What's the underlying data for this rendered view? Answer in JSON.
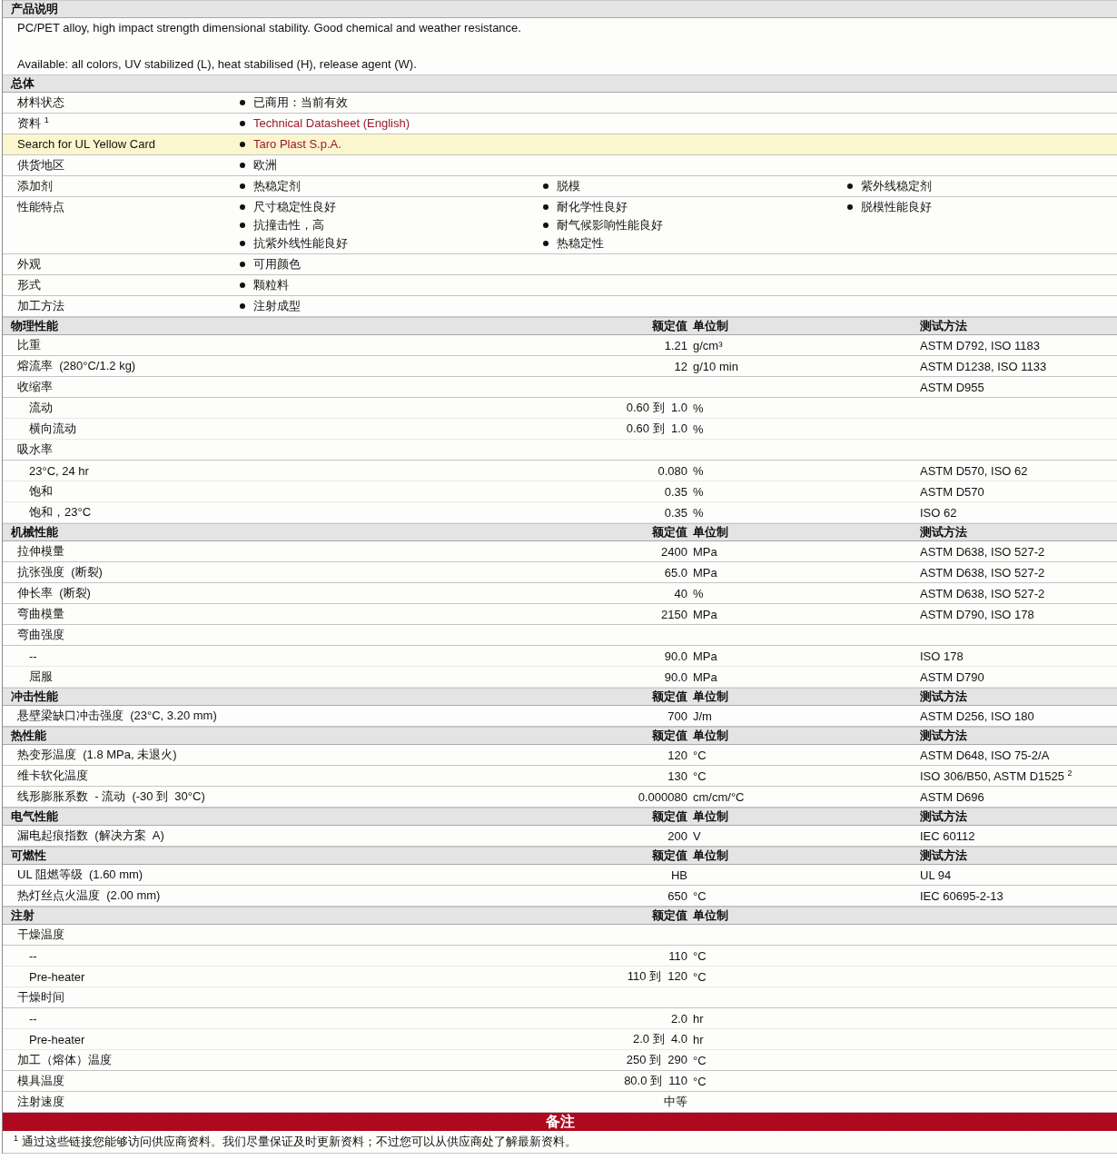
{
  "description": {
    "title": "产品说明",
    "paragraphs": [
      "PC/PET alloy, high impact strength dimensional stability. Good chemical and weather resistance.",
      "Available: all colors, UV stabilized (L), heat stabilised (H), release agent (W)."
    ]
  },
  "general": {
    "title": "总体",
    "rows": [
      {
        "label": "材料状态",
        "highlighted": false,
        "columns": [
          [
            {
              "text": "已商用：当前有效",
              "link": false
            }
          ]
        ]
      },
      {
        "label": "资料 $^{1}$",
        "highlighted": false,
        "columns": [
          [
            {
              "text": "Technical Datasheet (English)",
              "link": true
            }
          ]
        ]
      },
      {
        "label": "Search for UL Yellow Card",
        "highlighted": true,
        "columns": [
          [
            {
              "text": "Taro Plast S.p.A.",
              "link": true
            }
          ]
        ]
      },
      {
        "label": "供货地区",
        "highlighted": false,
        "columns": [
          [
            {
              "text": "欧洲",
              "link": false
            }
          ]
        ]
      },
      {
        "label": "添加剂",
        "highlighted": false,
        "columns": [
          [
            {
              "text": "热稳定剂",
              "link": false
            }
          ],
          [
            {
              "text": "脱模",
              "link": false
            }
          ],
          [
            {
              "text": "紫外线稳定剂",
              "link": false
            }
          ]
        ]
      },
      {
        "label": "性能特点",
        "highlighted": false,
        "columns": [
          [
            {
              "text": "尺寸稳定性良好",
              "link": false
            },
            {
              "text": "抗撞击性，高",
              "link": false
            },
            {
              "text": "抗紫外线性能良好",
              "link": false
            }
          ],
          [
            {
              "text": "耐化学性良好",
              "link": false
            },
            {
              "text": "耐气候影响性能良好",
              "link": false
            },
            {
              "text": "热稳定性",
              "link": false
            }
          ],
          [
            {
              "text": "脱模性能良好",
              "link": false
            }
          ]
        ]
      },
      {
        "label": "外观",
        "highlighted": false,
        "columns": [
          [
            {
              "text": "可用颜色",
              "link": false
            }
          ]
        ]
      },
      {
        "label": "形式",
        "highlighted": false,
        "columns": [
          [
            {
              "text": "颗粒料",
              "link": false
            }
          ]
        ]
      },
      {
        "label": "加工方法",
        "highlighted": false,
        "columns": [
          [
            {
              "text": "注射成型",
              "link": false
            }
          ]
        ]
      }
    ]
  },
  "sections": [
    {
      "title": "物理性能",
      "value_header": "额定值",
      "unit_header": "单位制",
      "method_header": "测试方法",
      "rows": [
        {
          "label": "比重",
          "value": "1.21",
          "unit": "g/cm³",
          "method": "ASTM D792, ISO 1183"
        },
        {
          "label": "熔流率  (280°C/1.2 kg)",
          "value": "12",
          "unit": "g/10 min",
          "method": "ASTM D1238, ISO 1133"
        },
        {
          "label": "收缩率",
          "method": "ASTM D955",
          "children": [
            {
              "label": "流动",
              "value": "0.60 到  1.0",
              "unit": "%"
            },
            {
              "label": "横向流动",
              "value": "0.60 到  1.0",
              "unit": "%"
            }
          ]
        },
        {
          "label": "吸水率",
          "children": [
            {
              "label": "23°C, 24 hr",
              "value": "0.080",
              "unit": "%",
              "method": "ASTM D570, ISO 62"
            },
            {
              "label": "饱和",
              "value": "0.35",
              "unit": "%",
              "method": "ASTM D570"
            },
            {
              "label": "饱和，23°C",
              "value": "0.35",
              "unit": "%",
              "method": "ISO 62"
            }
          ]
        }
      ]
    },
    {
      "title": "机械性能",
      "value_header": "额定值",
      "unit_header": "单位制",
      "method_header": "测试方法",
      "rows": [
        {
          "label": "拉伸模量",
          "value": "2400",
          "unit": "MPa",
          "method": "ASTM D638, ISO 527-2"
        },
        {
          "label": "抗张强度  (断裂)",
          "value": "65.0",
          "unit": "MPa",
          "method": "ASTM D638, ISO 527-2"
        },
        {
          "label": "伸长率  (断裂)",
          "value": "40",
          "unit": "%",
          "method": "ASTM D638, ISO 527-2"
        },
        {
          "label": "弯曲模量",
          "value": "2150",
          "unit": "MPa",
          "method": "ASTM D790, ISO 178"
        },
        {
          "label": "弯曲强度",
          "children": [
            {
              "label": "--",
              "value": "90.0",
              "unit": "MPa",
              "method": "ISO 178"
            },
            {
              "label": "屈服",
              "value": "90.0",
              "unit": "MPa",
              "method": "ASTM D790"
            }
          ]
        }
      ]
    },
    {
      "title": "冲击性能",
      "value_header": "额定值",
      "unit_header": "单位制",
      "method_header": "测试方法",
      "rows": [
        {
          "label": "悬壁梁缺口冲击强度  (23°C, 3.20 mm)",
          "value": "700",
          "unit": "J/m",
          "method": "ASTM D256, ISO 180"
        }
      ]
    },
    {
      "title": "热性能",
      "value_header": "额定值",
      "unit_header": "单位制",
      "method_header": "测试方法",
      "rows": [
        {
          "label": "热变形温度  (1.8 MPa, 未退火)",
          "value": "120",
          "unit": "°C",
          "method": "ASTM D648, ISO 75-2/A"
        },
        {
          "label": "维卡软化温度",
          "value": "130",
          "unit": "°C",
          "method": "ISO 306/B50, ASTM D1525 $^{2}$"
        },
        {
          "label": "线形膨胀系数  - 流动  (-30 到  30°C)",
          "value": "0.000080",
          "unit": "cm/cm/°C",
          "method": "ASTM D696"
        }
      ]
    },
    {
      "title": "电气性能",
      "value_header": "额定值",
      "unit_header": "单位制",
      "method_header": "测试方法",
      "rows": [
        {
          "label": "漏电起痕指数  (解决方案  A)",
          "value": "200",
          "unit": "V",
          "method": "IEC 60112"
        }
      ]
    },
    {
      "title": "可燃性",
      "value_header": "额定值",
      "unit_header": "单位制",
      "method_header": "测试方法",
      "rows": [
        {
          "label": "UL 阻燃等级  (1.60 mm)",
          "value": "HB",
          "method": "UL 94"
        },
        {
          "label": "热灯丝点火温度  (2.00 mm)",
          "value": "650",
          "unit": "°C",
          "method": "IEC 60695-2-13"
        }
      ]
    },
    {
      "title": "注射",
      "value_header": "额定值",
      "unit_header": "单位制",
      "rows": [
        {
          "label": "干燥温度",
          "children": [
            {
              "label": "--",
              "value": "110",
              "unit": "°C"
            },
            {
              "label": "Pre-heater",
              "value": "110 到  120",
              "unit": "°C"
            }
          ]
        },
        {
          "label": "干燥时间",
          "children": [
            {
              "label": "--",
              "value": "2.0",
              "unit": "hr"
            },
            {
              "label": "Pre-heater",
              "value": "2.0 到  4.0",
              "unit": "hr"
            }
          ]
        },
        {
          "label": "加工（熔体）温度",
          "value": "250 到  290",
          "unit": "°C"
        },
        {
          "label": "模具温度",
          "value": "80.0 到  110",
          "unit": "°C"
        },
        {
          "label": "注射速度",
          "value": "中等"
        }
      ]
    }
  ],
  "notes": {
    "title": "备注",
    "footnotes": [
      "$^{1}$ 通过这些链接您能够访问供应商资料。我们尽量保证及时更新资料；不过您可以从供应商处了解最新资料。"
    ]
  }
}
